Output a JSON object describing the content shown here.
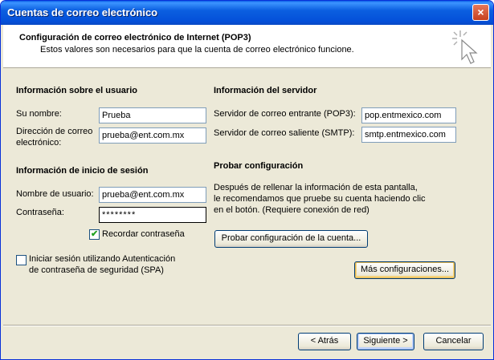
{
  "window": {
    "title": "Cuentas de correo electrónico",
    "close_glyph": "×"
  },
  "header": {
    "title": "Configuración de correo electrónico de Internet (POP3)",
    "subtitle": "Estos valores son necesarios para que la cuenta de correo electrónico funcione."
  },
  "user_info": {
    "section": "Información sobre el usuario",
    "name_label": "Su nombre:",
    "name_value": "Prueba",
    "email_label_1": "Dirección de correo",
    "email_label_2": "electrónico:",
    "email_value": "prueba@ent.com.mx"
  },
  "login_info": {
    "section": "Información de inicio de sesión",
    "username_label": "Nombre de usuario:",
    "username_value": "prueba@ent.com.mx",
    "password_label": "Contraseña:",
    "password_value": "********",
    "remember_label": "Recordar contraseña",
    "remember_checked": true,
    "spa_label_1": "Iniciar sesión utilizando Autenticación",
    "spa_label_2": "de contraseña de seguridad (SPA)",
    "spa_checked": false
  },
  "server_info": {
    "section": "Información del servidor",
    "incoming_label": "Servidor de correo entrante (POP3):",
    "incoming_value": "pop.entmexico.com",
    "outgoing_label": "Servidor de correo saliente (SMTP):",
    "outgoing_value": "smtp.entmexico.com"
  },
  "test": {
    "section": "Probar configuración",
    "desc_1": "Después de rellenar la información de esta pantalla,",
    "desc_2": "le recomendamos que pruebe su cuenta haciendo clic",
    "desc_3": "en el botón. (Requiere conexión de red)",
    "test_button": "Probar configuración de la cuenta...",
    "more_button": "Más configuraciones..."
  },
  "footer": {
    "back": "< Atrás",
    "next": "Siguiente >",
    "cancel": "Cancelar"
  },
  "icons": {
    "wizard": "cursor-sparkle-icon",
    "check": "checkmark-icon"
  }
}
